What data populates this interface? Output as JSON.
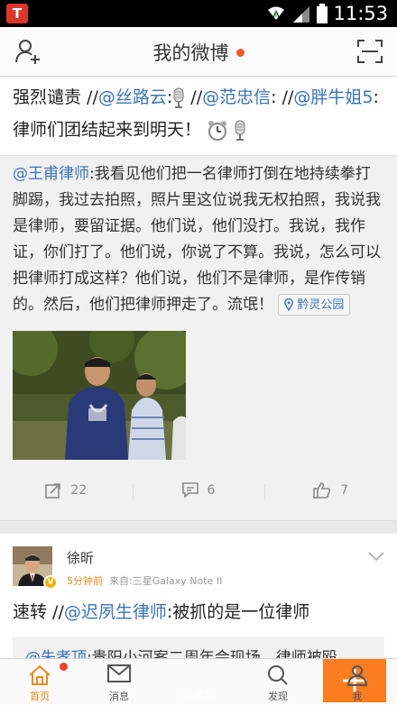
{
  "status_bar": {
    "app_icon_letter": "T",
    "time": "11:53"
  },
  "nav": {
    "title": "我的微博"
  },
  "post1": {
    "text_parts": [
      {
        "t": "强烈谴责 //",
        "m": false
      },
      {
        "t": "@丝路云",
        "m": true
      },
      {
        "t": ":",
        "m": false
      },
      {
        "t": " //",
        "m": false
      },
      {
        "t": "@范忠信",
        "m": true
      },
      {
        "t": ": //",
        "m": false
      },
      {
        "t": "@胖牛姐5",
        "m": true
      },
      {
        "t": ": 律师们团结起来到明天！",
        "m": false
      }
    ],
    "emoji_after_index2": "microphone-emoji",
    "emoji_end": [
      "alarm-clock-emoji",
      "microphone-emoji"
    ]
  },
  "repost": {
    "author": "@王甫律师",
    "text": ":我看见他们把一名律师打倒在地持续拳打脚踢，我过去拍照，照片里这位说我无权拍照，我说我是律师，要留证据。他们说，他们没打。我说，我作证，你们打了。他们说，你说了不算。我说，怎么可以把律师打成这样？他们说，他们不是律师，是作传销的。然后，他们把律师押走了。流氓！",
    "location": "黔灵公园"
  },
  "actions": {
    "repost_count": "22",
    "comment_count": "6",
    "like_count": "7"
  },
  "post2": {
    "username": "徐昕",
    "time": "5分钟前",
    "source": "来自:三星Galaxy Note II",
    "text_prefix": "速转 //",
    "mention": "@迟夙生律师",
    "text_suffix": ":被抓的是一位律师",
    "repost_author": "@朱孝顶",
    "repost_text": ":贵阳小河案二周年会现场，律师被殴"
  },
  "tabs": [
    {
      "label": "首页",
      "icon": "home-icon"
    },
    {
      "label": "消息",
      "icon": "message-icon"
    },
    {
      "label": "",
      "icon": "plus-icon"
    },
    {
      "label": "发现",
      "icon": "search-icon"
    },
    {
      "label": "我",
      "icon": "profile-icon"
    }
  ],
  "watermark": "@徐昕",
  "colors": {
    "accent": "#fb7d1f",
    "mention": "#3a73b8",
    "badge": "#f25a2b"
  }
}
